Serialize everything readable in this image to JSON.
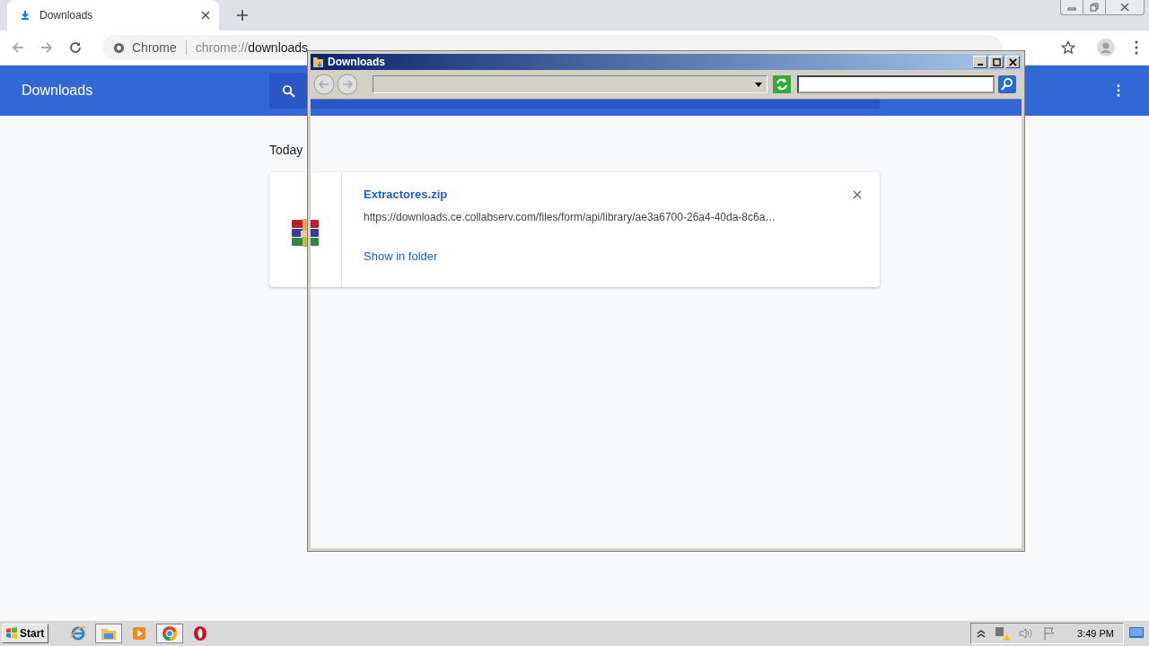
{
  "browser": {
    "tab": {
      "title": "Downloads"
    },
    "address": {
      "site": "Chrome",
      "url_prefix": "chrome://",
      "url_path": "downloads"
    }
  },
  "page": {
    "title": "Downloads",
    "section": "Today",
    "downloads": [
      {
        "file_name": "Extractores.zip",
        "url": "https://downloads.ce.collabserv.com/files/form/api/library/ae3a6700-26a4-40da-8c6a…",
        "action": "Show in folder"
      }
    ]
  },
  "explorer_window": {
    "title": "Downloads"
  },
  "taskbar": {
    "start": "Start",
    "apps": [
      {
        "kind": "ie",
        "selected": false
      },
      {
        "kind": "folder",
        "selected": true
      },
      {
        "kind": "media",
        "selected": false
      },
      {
        "kind": "chrome",
        "selected": true
      },
      {
        "kind": "opera",
        "selected": false
      }
    ],
    "clock": "3:49 PM"
  }
}
